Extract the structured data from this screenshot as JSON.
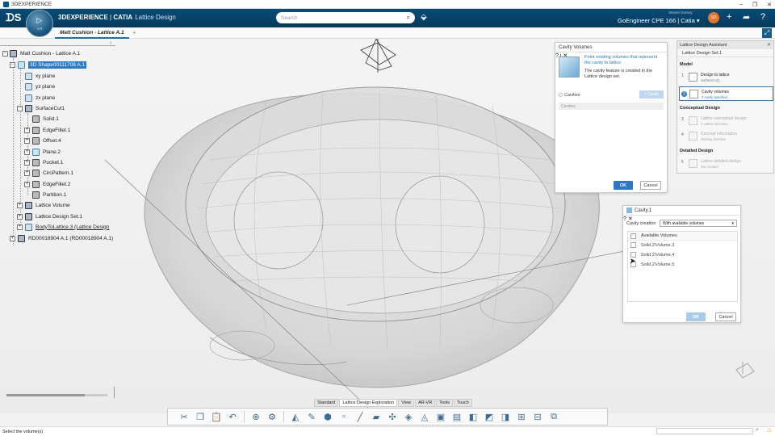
{
  "window": {
    "title": "3DEXPERIENCE",
    "minimize": "–",
    "maximize": "❐",
    "close": "✕"
  },
  "topbar": {
    "brand_bold": "3DEXPERIENCE",
    "brand_sep": " | ",
    "brand_product": "CATIA",
    "brand_app": "Lattice Design",
    "compass_version": "V.R",
    "search_placeholder": "Search",
    "user_name": "Steven Dorsey",
    "context_label": "GoEngineer CPE 166 | Catia ▾",
    "avatar_text": "SD"
  },
  "tabs": {
    "active": "Matt Cushion - Lattice A.1",
    "add": "+"
  },
  "tree": {
    "nodes": [
      {
        "label": "Matt Cushion - Lattice A.1"
      },
      {
        "label": "3D Shape00111708 A.1"
      },
      {
        "label": "xy plane"
      },
      {
        "label": "yz plane"
      },
      {
        "label": "zx plane"
      },
      {
        "label": "SurfaceCut1"
      },
      {
        "label": "Solid.1"
      },
      {
        "label": "EdgeFillet.1"
      },
      {
        "label": "Offset.4"
      },
      {
        "label": "Plane.2"
      },
      {
        "label": "Pocket.1"
      },
      {
        "label": "CircPattern.1"
      },
      {
        "label": "EdgeFillet.2"
      },
      {
        "label": "Partition.1"
      },
      {
        "label": "Lattice Volume"
      },
      {
        "label": "Lattice Design Set.1"
      },
      {
        "label": "BodyToLattice.3 (Lattice Design"
      },
      {
        "label": "RD00018904 A.1 (RD00018904 A.1)"
      }
    ]
  },
  "cavity_volumes_panel": {
    "title": "Cavity Volumes",
    "help_icon": "?",
    "info_icon": "i",
    "close_icon": "✕",
    "description": "Point existing volumes that represent the cavity to lattice",
    "note": "The cavity feature is created in the Lattice design set.",
    "cavities_label": "Cavities",
    "add_button": "+ Cavity",
    "list_placeholder": "Cavities",
    "ok": "OK",
    "cancel": "Cancel"
  },
  "assistant": {
    "title": "Lattice Design Assistant",
    "close_icon": "✕",
    "subtitle": "Lattice Design Set.1",
    "sections": {
      "model": "Model",
      "conceptual": "Conceptual Design",
      "detailed": "Detailed Design"
    },
    "steps": [
      {
        "num": "1",
        "title": "Design to lattice",
        "sub": "SurfaceCut1"
      },
      {
        "num": "2",
        "title": "Cavity volumes",
        "sub": "0 cavity specified"
      },
      {
        "num": "3",
        "title": "Lattice conceptual design",
        "sub": "0 Lattice selection"
      },
      {
        "num": "4",
        "title": "Concept information",
        "sub": "Missing direction"
      },
      {
        "num": "5",
        "title": "Lattice detailed design",
        "sub": "Not created"
      }
    ]
  },
  "cavity1_dialog": {
    "title": "Cavity.1",
    "help_icon": "?",
    "close_icon": "✕",
    "creation_label": "Cavity creation",
    "creation_value": "With available volumes",
    "column_header": "Available Volumes",
    "volumes": [
      "Solid.2\\Volume.3",
      "Solid.2\\Volume.4",
      "Solid.2\\Volume.5"
    ],
    "ok": "OK",
    "cancel": "Cancel"
  },
  "toolbar": {
    "tabs": [
      "Standard",
      "Lattice Design Exploration",
      "View",
      "AR-VR",
      "Tools",
      "Touch"
    ],
    "active_tab": "Lattice Design Exploration"
  },
  "status": {
    "message": "Select the volume(s)"
  }
}
